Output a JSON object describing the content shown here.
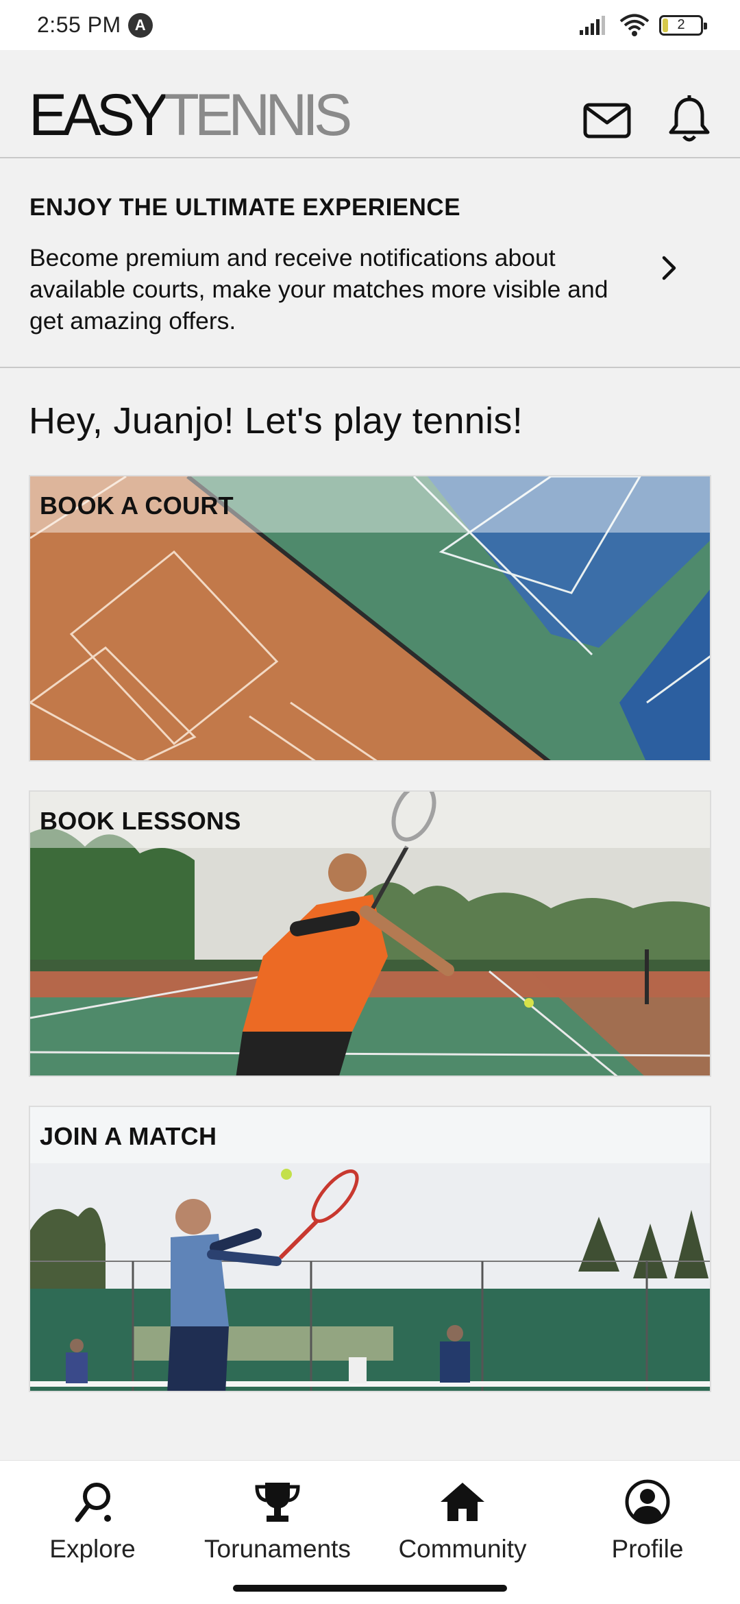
{
  "status_bar": {
    "time": "2:55 PM",
    "notification_badge": "A",
    "battery_level": "2",
    "icons": [
      "signal-icon",
      "wifi-icon",
      "battery-icon"
    ]
  },
  "header": {
    "logo_part1": "EASY",
    "logo_part2": "TENNIS",
    "icons": [
      "mail-icon",
      "bell-icon"
    ]
  },
  "promo": {
    "title": "ENJOY THE ULTIMATE EXPERIENCE",
    "text": "Become premium and receive notifications about available courts, make your matches more visible and get amazing offers."
  },
  "greeting": "Hey, Juanjo! Let's play tennis!",
  "cards": [
    {
      "label": "BOOK A COURT"
    },
    {
      "label": "BOOK LESSONS"
    },
    {
      "label": "JOIN A MATCH"
    }
  ],
  "bottom_nav": [
    {
      "label": "Explore",
      "icon": "explore-icon"
    },
    {
      "label": "Torunaments",
      "icon": "trophy-icon"
    },
    {
      "label": "Community",
      "icon": "home-icon"
    },
    {
      "label": "Profile",
      "icon": "profile-icon"
    }
  ],
  "colors": {
    "background": "#f1f1f1",
    "logo_secondary": "#8a8a8a",
    "text": "#111111"
  }
}
